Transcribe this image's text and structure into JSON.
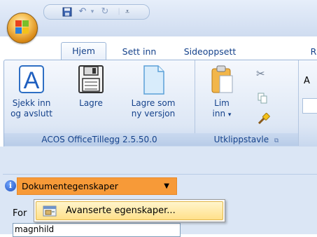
{
  "colors": {
    "accent_orange": "#f79a38",
    "ribbon_text": "#15428b",
    "menu_highlight": "#ffe08a"
  },
  "quick_access": {
    "icons": [
      "save-icon",
      "undo-icon",
      "redo-icon",
      "customize-dropdown-icon"
    ]
  },
  "tabs": [
    {
      "label": "Hjem",
      "active": true
    },
    {
      "label": "Sett inn",
      "active": false
    },
    {
      "label": "Sideoppsett",
      "active": false
    },
    {
      "label": "R",
      "active": false
    }
  ],
  "ribbon": {
    "groups": [
      {
        "label": "ACOS OfficeTillegg 2.5.50.0",
        "buttons": [
          {
            "line1": "Sjekk inn",
            "line2": "og avslutt",
            "icon": "check-in-icon"
          },
          {
            "line1": "Lagre",
            "line2": "",
            "icon": "save-icon"
          },
          {
            "line1": "Lagre som",
            "line2": "ny versjon",
            "icon": "new-document-icon"
          }
        ]
      },
      {
        "label": "Utklippstavle",
        "buttons": [
          {
            "line1": "Lim",
            "line2": "inn",
            "icon": "paste-icon"
          }
        ],
        "small_icons": [
          "cut-icon",
          "copy-icon",
          "format-painter-icon"
        ]
      }
    ],
    "partial_text": "A"
  },
  "info_bar": {
    "icon": "info-icon",
    "dropdown_label": "Dokumentegenskaper",
    "dropdown_icon": "caret-down-icon"
  },
  "context_menu": {
    "items": [
      {
        "label": "Avanserte egenskaper...",
        "icon": "properties-icon"
      }
    ]
  },
  "form": {
    "label_partial": "For",
    "field_value": "magnhild"
  }
}
